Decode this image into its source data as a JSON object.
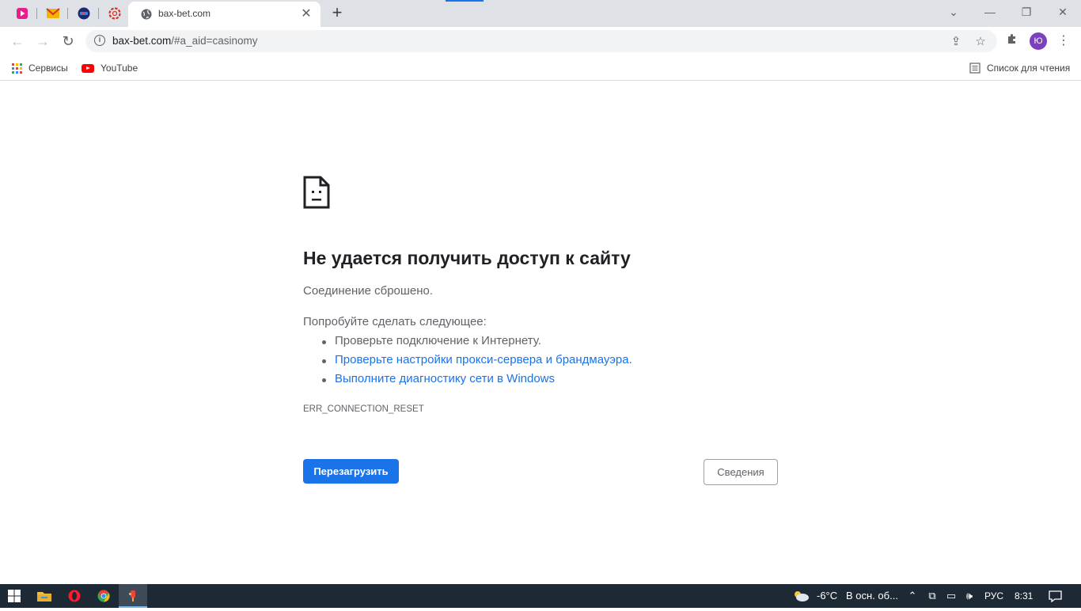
{
  "browser": {
    "active_tab": {
      "title": "bax-bet.com"
    },
    "url": {
      "host": "bax-bet.com",
      "path": "/#a_aid=casinomy"
    }
  },
  "bookmarks": {
    "services": "Сервисы",
    "youtube": "YouTube",
    "reading_list": "Список для чтения"
  },
  "profile": {
    "initial": "Ю"
  },
  "error_page": {
    "heading": "Не удается получить доступ к сайту",
    "summary": "Соединение сброшено.",
    "suggest_title": "Попробуйте сделать следующее:",
    "suggestions": [
      "Проверьте подключение к Интернету.",
      "Проверьте настройки прокси-сервера и брандмауэра",
      "Выполните диагностику сети в Windows"
    ],
    "period": ".",
    "error_code": "ERR_CONNECTION_RESET",
    "reload_button": "Перезагрузить",
    "details_button": "Сведения"
  },
  "taskbar": {
    "weather_temp": "-6°C",
    "weather_desc": "В осн. об...",
    "language": "РУС",
    "time": "8:31"
  },
  "colors": {
    "accent_blue": "#1a73e8",
    "tab_strip": "#dee1e6",
    "taskbar": "#1d2935",
    "avatar": "#7b3fbf"
  }
}
